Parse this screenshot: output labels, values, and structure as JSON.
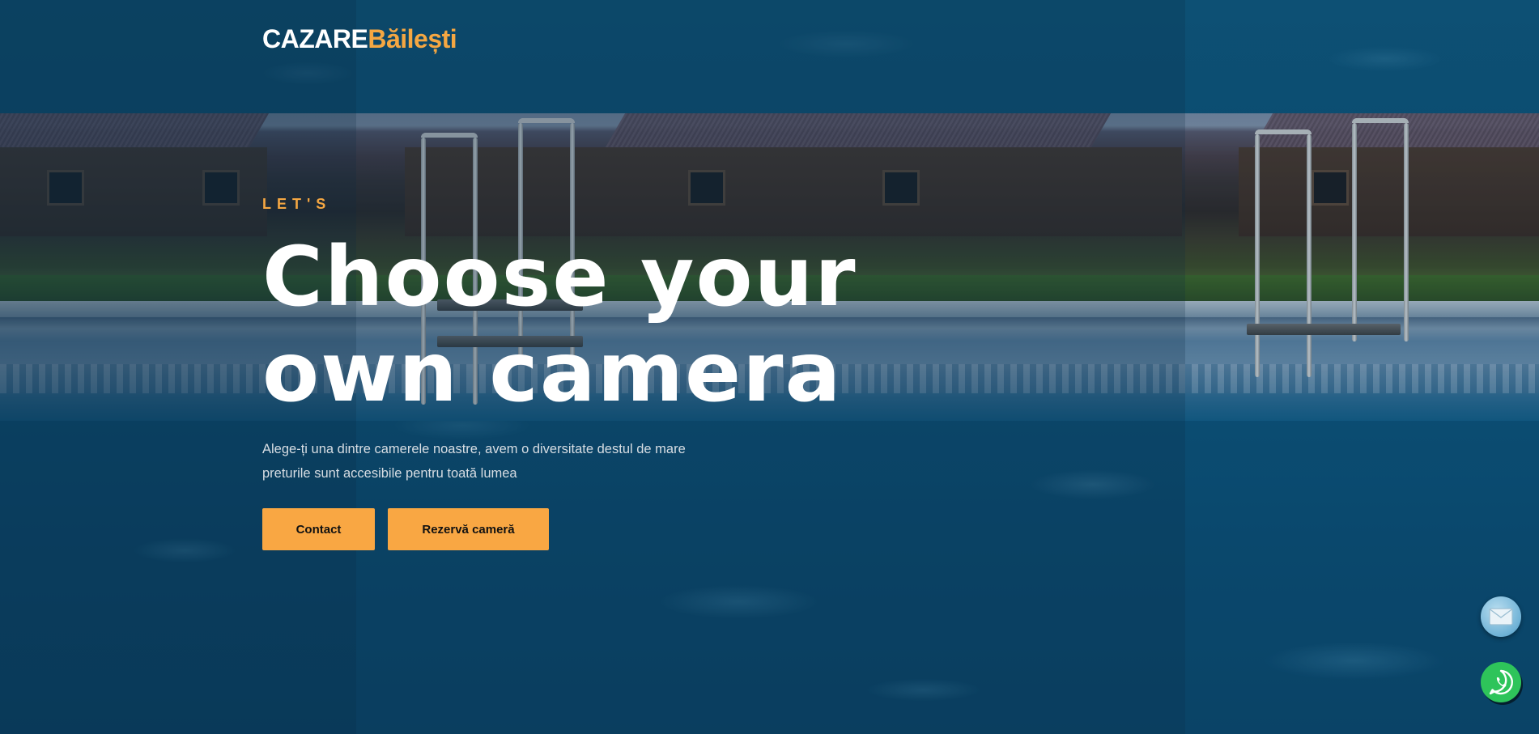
{
  "brand": {
    "part1": "CAZARE",
    "part2": "Băilești"
  },
  "hero": {
    "eyebrow": "LET'S",
    "headline_line1": "Choose your",
    "headline_line2": "own camera",
    "sub_line1": "Alege-ți una dintre camerele noastre, avem o diversitate destul de mare",
    "sub_line2": "preturile sunt accesibile pentru toată lumea",
    "buttons": {
      "contact": "Contact",
      "book": "Rezervă cameră"
    }
  },
  "floating": {
    "mail_icon": "envelope-icon",
    "whatsapp_icon": "whatsapp-icon"
  },
  "colors": {
    "accent": "#f5a742",
    "button_bg": "#f9a743",
    "text_light": "#ffffff",
    "whatsapp": "#2ec45a"
  }
}
